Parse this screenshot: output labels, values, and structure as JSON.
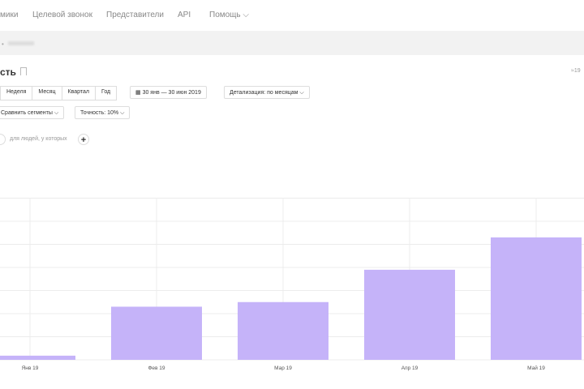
{
  "nav": {
    "items": [
      "мики",
      "Целевой звонок",
      "Представители",
      "API",
      "Помощь ⌵"
    ]
  },
  "breadcrumb": {
    "sep": "•"
  },
  "header": {
    "title": "сть",
    "right": "≈19"
  },
  "periods": [
    "Неделя",
    "Месяц",
    "Квартал",
    "Год"
  ],
  "date_range": "30 янв — 30 июн 2019",
  "detail": "Детализация: по месяцам ⌵",
  "compare": "Сравнить сегменты ⌵",
  "accuracy": "Точность: 10% ⌵",
  "filter": {
    "text": "для людей, у которых",
    "add": "+"
  },
  "chart_data": {
    "type": "bar",
    "categories": [
      "Янв 19",
      "Фев 19",
      "Мар 19",
      "Апр 19",
      "Май 19"
    ],
    "values": [
      0.18,
      2.3,
      2.5,
      3.9,
      5.3
    ],
    "ylim": [
      0,
      7
    ],
    "grid": true,
    "color": "#c5b3f9",
    "title": "",
    "xlabel": "",
    "ylabel": ""
  }
}
